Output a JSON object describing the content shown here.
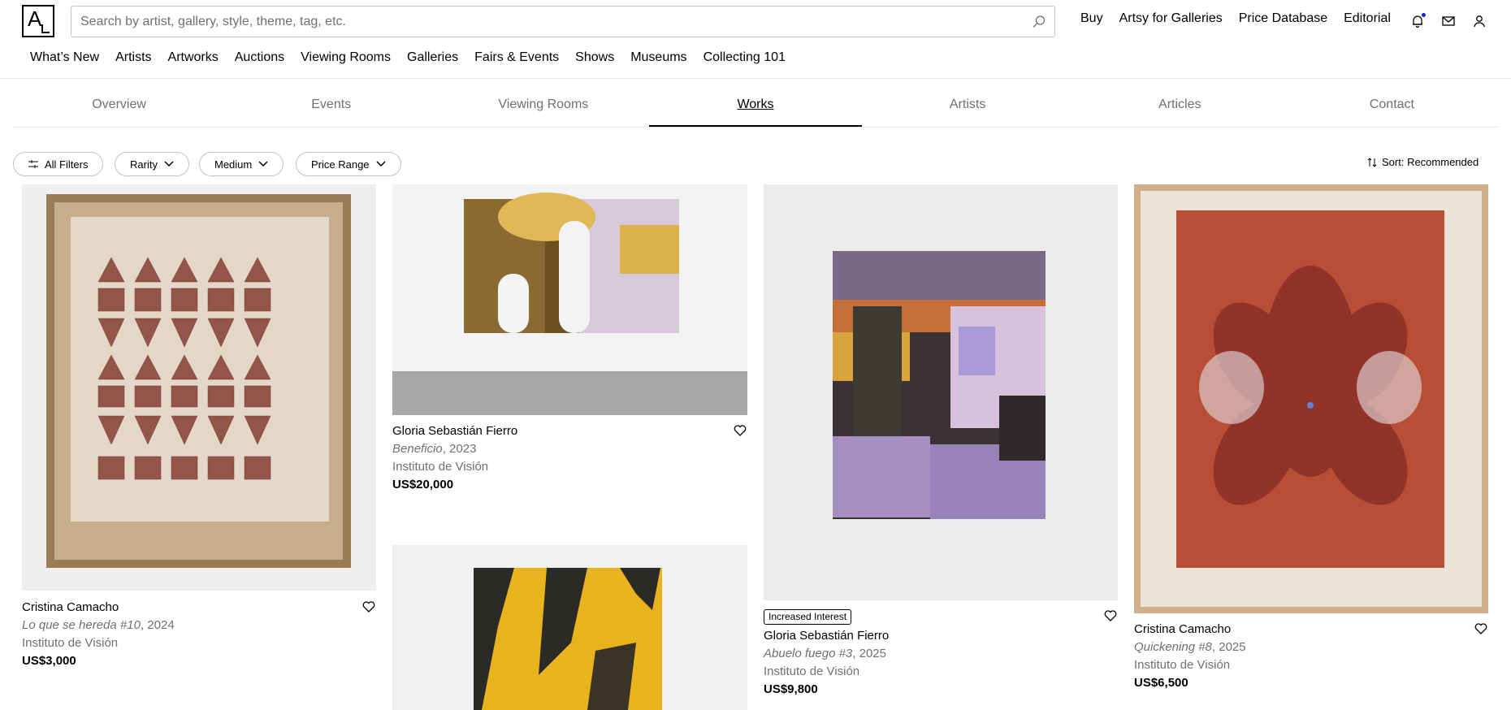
{
  "header": {
    "logo": "A",
    "search_placeholder": "Search by artist, gallery, style, theme, tag, etc.",
    "top_links": [
      "Buy",
      "Artsy for Galleries",
      "Price Database",
      "Editorial"
    ],
    "icons": [
      "bell-icon",
      "mail-icon",
      "user-icon"
    ],
    "main_nav": [
      "What’s New",
      "Artists",
      "Artworks",
      "Auctions",
      "Viewing Rooms",
      "Galleries",
      "Fairs & Events",
      "Shows",
      "Museums",
      "Collecting 101"
    ]
  },
  "tabs": [
    "Overview",
    "Events",
    "Viewing Rooms",
    "Works",
    "Artists",
    "Articles",
    "Contact"
  ],
  "active_tab": "Works",
  "filters": {
    "all": "All Filters",
    "rarity": "Rarity",
    "medium": "Medium",
    "price": "Price Range",
    "sort": "Sort: Recommended"
  },
  "artworks": [
    {
      "artist": "Cristina Camacho",
      "title": "Lo que se hereda #10",
      "year": ", 2024",
      "gallery": "Instituto de Visión",
      "price": "US$3,000"
    },
    {
      "artist": "Gloria Sebastián Fierro",
      "title": "Beneficio",
      "year": ", 2023",
      "gallery": "Instituto de Visión",
      "price": "US$20,000"
    },
    {
      "badge": "Increased Interest",
      "artist": "Gloria Sebastián Fierro",
      "title": "Abuelo fuego #3",
      "year": ", 2025",
      "gallery": "Instituto de Visión",
      "price": "US$9,800"
    },
    {
      "artist": "Cristina Camacho",
      "title": "Quickening #8",
      "year": ", 2025",
      "gallery": "Instituto de Visión",
      "price": "US$6,500"
    }
  ],
  "colors": {
    "accent": "#1023d7",
    "muted_text": "#707070",
    "border": "#c2c2c2"
  }
}
